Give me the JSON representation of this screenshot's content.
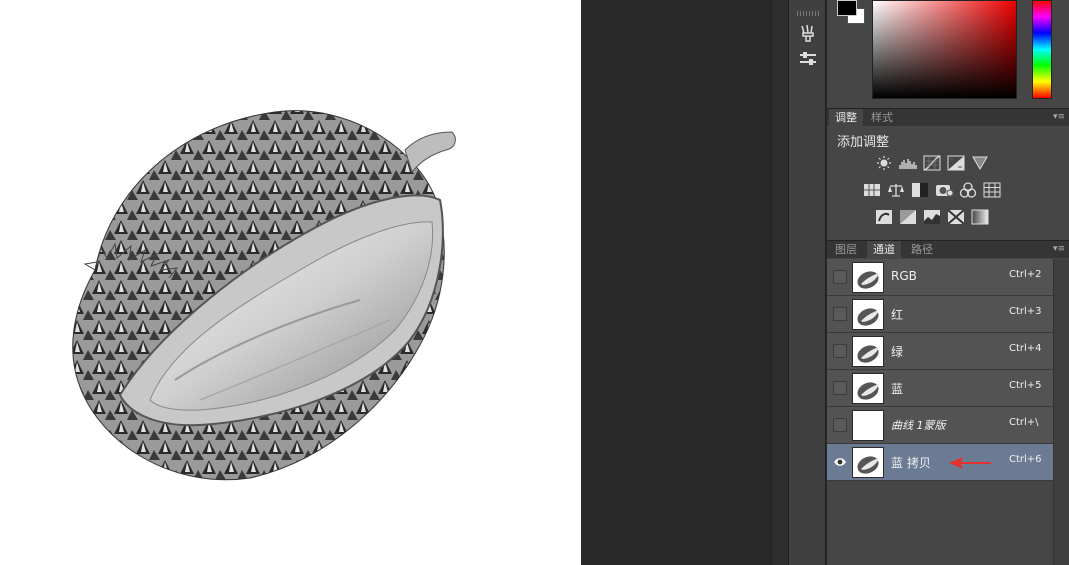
{
  "canvas": {
    "subject": "durian-image",
    "background": "#ffffff"
  },
  "adjustments_panel": {
    "tabs": [
      "调整",
      "样式"
    ],
    "active_tab": "调整",
    "title": "添加调整",
    "icons_row1": [
      "brightness-icon",
      "levels-icon",
      "curves-icon",
      "exposure-icon",
      "triangle-icon"
    ],
    "icons_row2": [
      "vibrance-icon",
      "balance-icon",
      "black-white-icon",
      "photo-filter-icon",
      "channel-mixer-icon",
      "color-lookup-icon"
    ],
    "icons_row3": [
      "invert-icon",
      "posterize-icon",
      "threshold-icon",
      "selective-color-icon",
      "gradient-map-icon"
    ]
  },
  "layers_panel": {
    "tabs": [
      "图层",
      "通道",
      "路径"
    ],
    "active_tab": "通道"
  },
  "channels": [
    {
      "name": "RGB",
      "shortcut": "Ctrl+2",
      "visible": false,
      "active": false,
      "italic": false
    },
    {
      "name": "红",
      "shortcut": "Ctrl+3",
      "visible": false,
      "active": false,
      "italic": false
    },
    {
      "name": "绿",
      "shortcut": "Ctrl+4",
      "visible": false,
      "active": false,
      "italic": false
    },
    {
      "name": "蓝",
      "shortcut": "Ctrl+5",
      "visible": false,
      "active": false,
      "italic": false
    },
    {
      "name": "曲线 1蒙版",
      "shortcut": "Ctrl+\\",
      "visible": false,
      "active": false,
      "italic": true
    },
    {
      "name": "蓝 拷贝",
      "shortcut": "Ctrl+6",
      "visible": true,
      "active": true,
      "italic": false
    }
  ],
  "colors": {
    "foreground": "#000000",
    "background": "#ffffff",
    "active_row": "#6b7b94",
    "annotation_arrow": "#e53030"
  }
}
